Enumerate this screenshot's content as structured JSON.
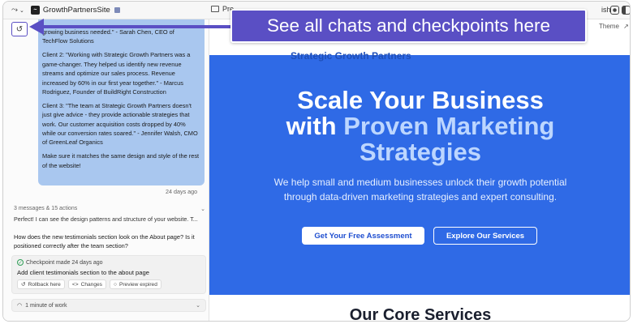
{
  "topbar": {
    "app_menu_icon": "route-icon",
    "project_name": "GrowthPartnersSite",
    "preview_tab": "Pre",
    "publish_label": "ish"
  },
  "sidebar": {
    "message_paragraphs": [
      "growing business needed.\" - Sarah Chen, CEO of TechFlow Solutions",
      "Client 2: \"Working with Strategic Growth Partners was a game-changer. They helped us identify new revenue streams and optimize our sales process. Revenue increased by 60% in our first year together.\" - Marcus Rodriguez, Founder of BuildRight Construction",
      "Client 3: \"The team at Strategic Growth Partners doesn't just give advice - they provide actionable strategies that work. Our customer acquisition costs dropped by 40% while our conversion rates soared.\" - Jennifer Walsh, CMO of GreenLeaf Organics",
      "Make sure it matches the same design and style of the rest of the website!"
    ],
    "message_time": "24 days ago",
    "actions_summary": "3 messages & 15 actions",
    "assistant_reply": "Perfect! I can see the design patterns and structure of your website. T...",
    "question": "How does the new testimonials section look on the About page? Is it positioned correctly after the team section?",
    "checkpoint": {
      "meta": "Checkpoint made 24 days ago",
      "title": "Add client testimonials section to the about page",
      "buttons": [
        "Rollback here",
        "Changes",
        "Preview expired"
      ]
    },
    "work_label": "1 minute of work"
  },
  "preview": {
    "theme_label": "Theme",
    "clipped_heading": "Strategic Growth Partners",
    "hero_line1": "Scale Your Business",
    "hero_line2_plain": "with ",
    "hero_line2_accent": "Proven Marketing",
    "hero_line3_accent": "Strategies",
    "hero_sub": "We help small and medium businesses unlock their growth potential through data-driven marketing strategies and expert consulting.",
    "cta_primary": "Get Your Free Assessment",
    "cta_secondary": "Explore Our Services",
    "section_title": "Our Core Services"
  },
  "annotation": {
    "callout_text": "See all chats and checkpoints here"
  },
  "colors": {
    "accent": "#5a4fc4",
    "hero_bg": "#2f6ae6",
    "bubble_bg": "#a9c7ef"
  }
}
